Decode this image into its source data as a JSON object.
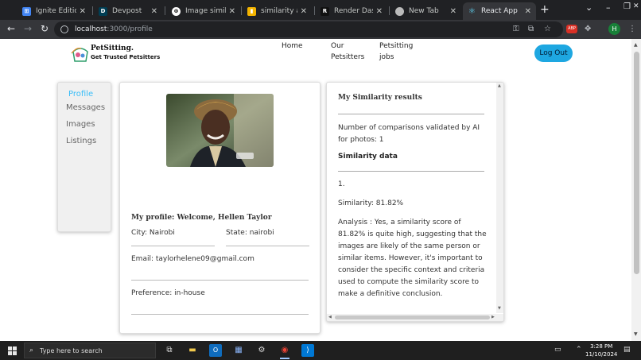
{
  "browser": {
    "tabs": [
      {
        "title": "Ignite Edition Cl",
        "icon": "windows-grid-icon",
        "color": "#4285f4"
      },
      {
        "title": "Devpost",
        "icon": "devpost-icon",
        "color": "#003e54"
      },
      {
        "title": "Image similarity",
        "icon": "openai-icon",
        "color": "#ffffff"
      },
      {
        "title": "similarity analys",
        "icon": "chart-icon",
        "color": "#f4b400"
      },
      {
        "title": "Render Dashbo",
        "icon": "render-icon",
        "color": "#111111"
      },
      {
        "title": "New Tab",
        "icon": "chrome-icon",
        "color": "#bbbbbb"
      },
      {
        "title": "React App",
        "icon": "react-icon",
        "color": "#61dafb"
      }
    ],
    "new_tab_label": "+",
    "window_controls": [
      "⌄",
      "–",
      "❐",
      "✕"
    ],
    "url_host": "localhost",
    "url_path": ":3000/profile",
    "extension_badge": "ABP",
    "profile_initial": "H"
  },
  "app": {
    "brand_name": "PetSitting.",
    "brand_tagline": "Get Trusted Petsitters",
    "nav": [
      {
        "line1": "Home",
        "line2": ""
      },
      {
        "line1": "Our",
        "line2": "Petsitters"
      },
      {
        "line1": "Petsitting",
        "line2": "jobs"
      }
    ],
    "logout_label": "Log Out",
    "sidebar": [
      "Profile",
      "Messages",
      "Images",
      "Listings"
    ],
    "profile": {
      "title": "My profile: Welcome, Hellen Taylor",
      "city": "City: Nairobi",
      "state": "State: nairobi",
      "email": "Email: taylorhelene09@gmail.com",
      "preference": "Preference: in-house"
    },
    "similarity": {
      "title": "My Similarity results",
      "comparisons": "Number of comparisons validated by AI for photos: 1",
      "data_heading": "Similarity data",
      "index": "1.",
      "score": "Similarity: 81.82%",
      "analysis": "Analysis : Yes, a similarity score of 81.82% is quite high, suggesting that the images are likely of the same person or similar items. However, it's important to consider the specific context and criteria used to compute the similarity score to make a definitive conclusion."
    }
  },
  "taskbar": {
    "search_placeholder": "Type here to search",
    "time": "3:28 PM",
    "date": "11/10/2024"
  },
  "colors": {
    "accent": "#1ea7e1",
    "sidebar_active": "#38bdf8"
  }
}
